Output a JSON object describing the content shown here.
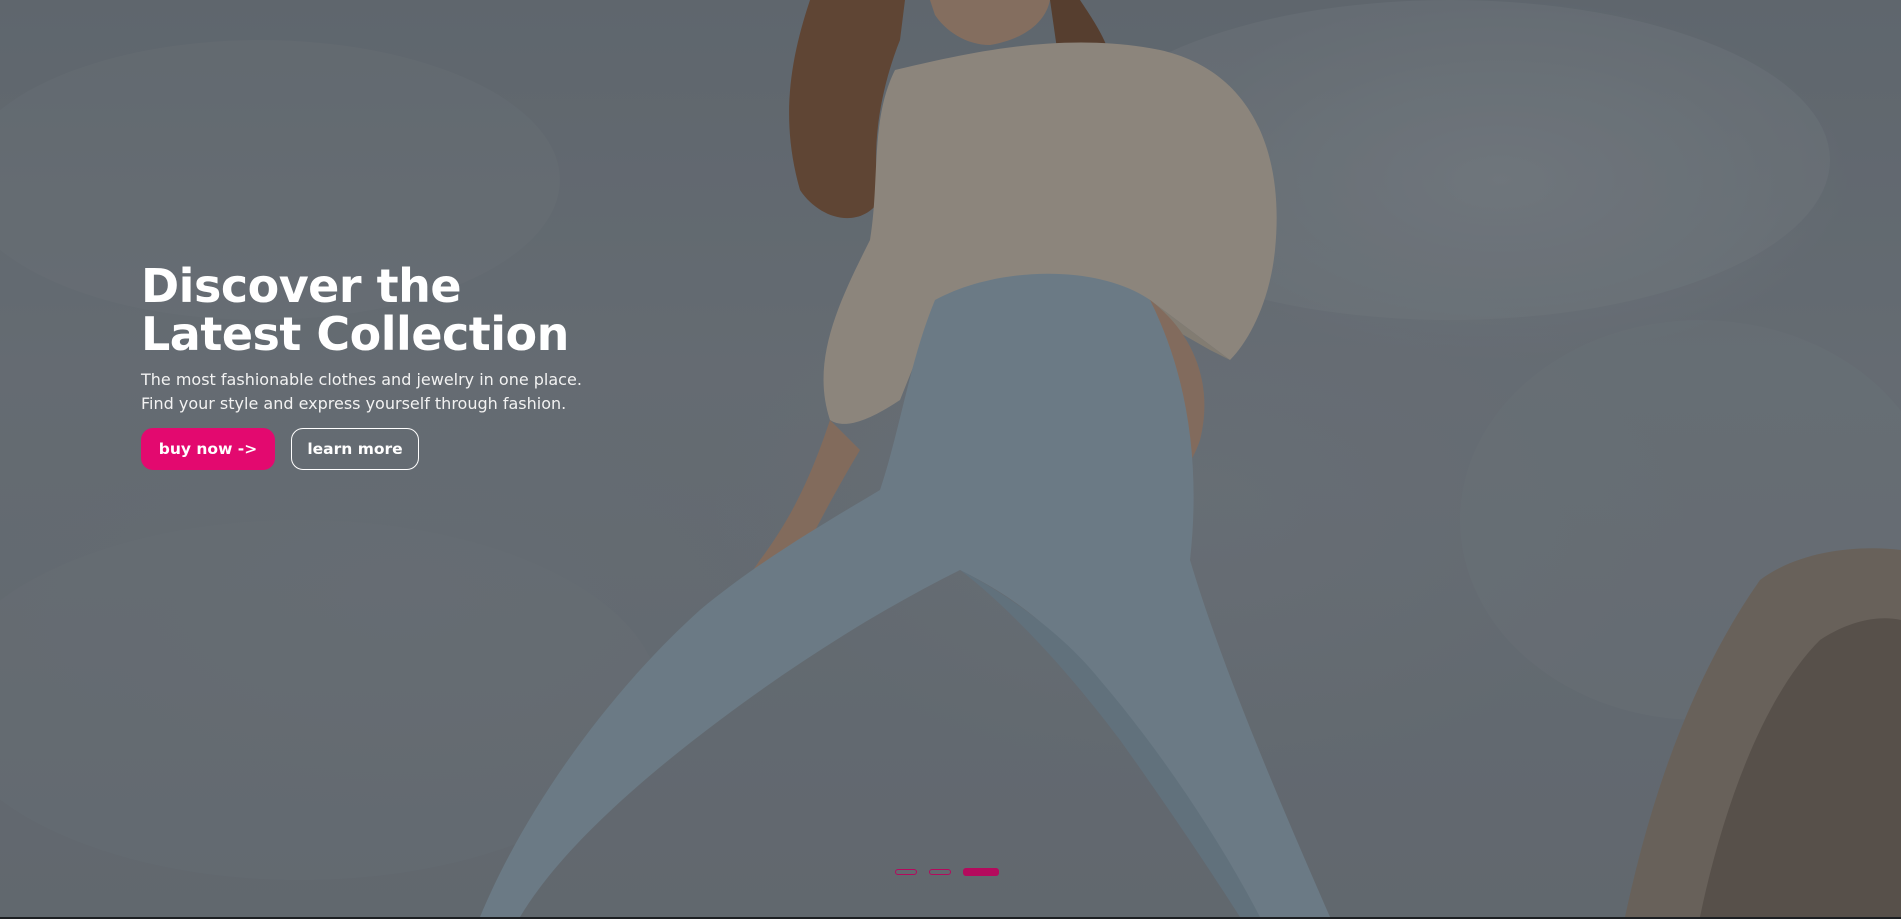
{
  "hero": {
    "headline": "Discover the Latest Collection",
    "subtitle": "The most fashionable clothes and jewelry in one place. Find your style and express yourself through fashion.",
    "primary_button": "buy now ->",
    "secondary_button": "learn more",
    "background_image": "woman-in-beige-shirt-and-jeans-photo",
    "slider": {
      "total_slides": 3,
      "active_slide": 3
    }
  },
  "colors": {
    "accent": "#e3096f",
    "dot": "#b40a5d",
    "text": "#ffffff"
  }
}
